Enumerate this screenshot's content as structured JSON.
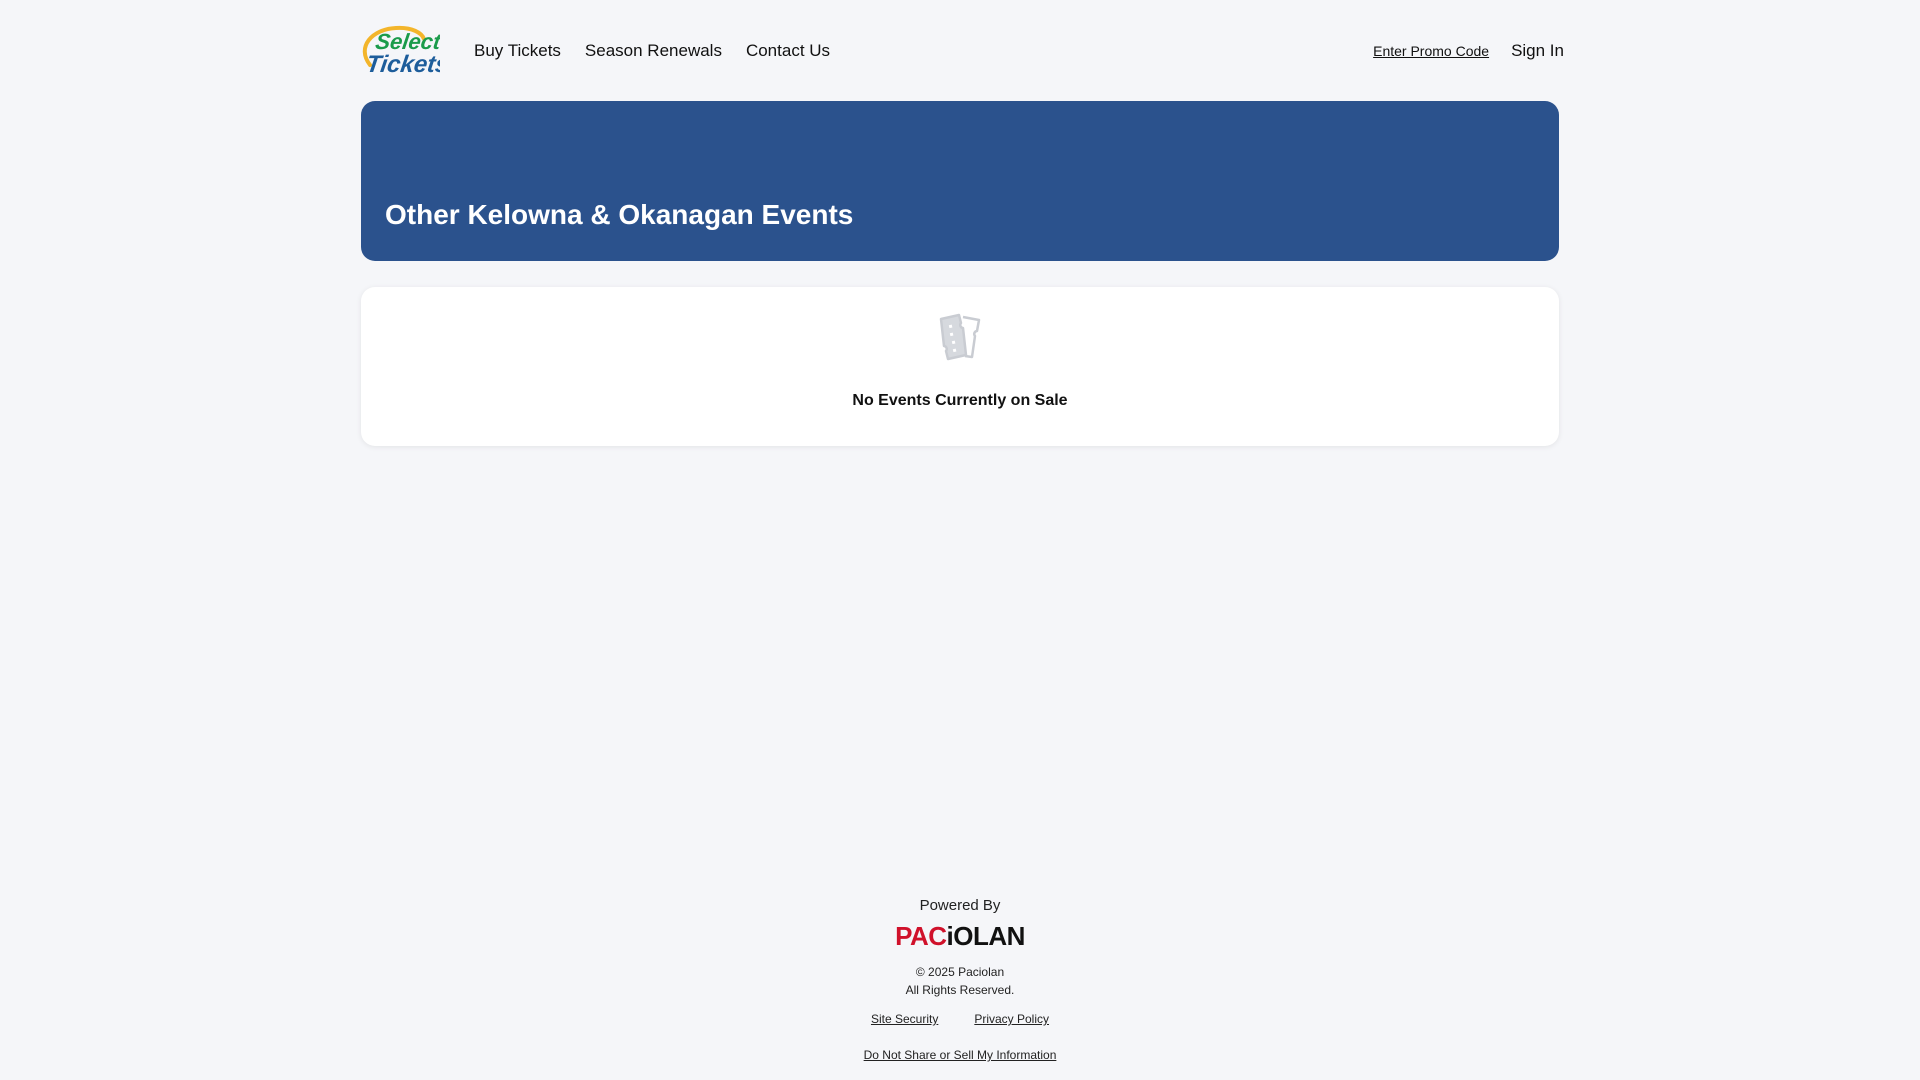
{
  "header": {
    "logo_alt": "Select Tickets",
    "nav": [
      {
        "label": "Buy Tickets"
      },
      {
        "label": "Season Renewals"
      },
      {
        "label": "Contact Us"
      }
    ],
    "promo_label": "Enter Promo Code",
    "signin_label": "Sign In"
  },
  "hero": {
    "title": "Other Kelowna & Okanagan Events",
    "background": "#2b528d"
  },
  "events": {
    "empty_icon": "ticket-icon",
    "empty_message": "No Events Currently on Sale"
  },
  "footer": {
    "powered_by": "Powered By",
    "brand": "PACIOLAN",
    "copyright": "© 2025 Paciolan",
    "rights": "All Rights Reserved.",
    "links": [
      {
        "label": "Site Security"
      },
      {
        "label": "Privacy Policy"
      }
    ],
    "do_not_sell": "Do Not Share or Sell My Information"
  }
}
